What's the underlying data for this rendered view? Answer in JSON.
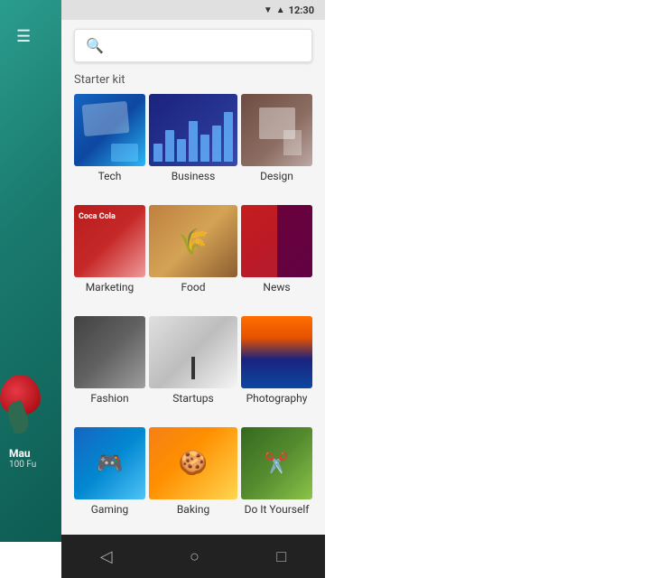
{
  "statusBar": {
    "time": "12:30"
  },
  "header": {
    "hamburgerIcon": "≡",
    "searchPlaceholder": ""
  },
  "sectionLabel": "Starter kit",
  "categories": [
    {
      "id": "tech",
      "label": "Tech",
      "thumbClass": "thumb-tech"
    },
    {
      "id": "business",
      "label": "Business",
      "thumbClass": "thumb-business"
    },
    {
      "id": "design",
      "label": "Design",
      "thumbClass": "thumb-design"
    },
    {
      "id": "marketing",
      "label": "Marketing",
      "thumbClass": "thumb-marketing"
    },
    {
      "id": "food",
      "label": "Food",
      "thumbClass": "thumb-food"
    },
    {
      "id": "news",
      "label": "News",
      "thumbClass": "thumb-news"
    },
    {
      "id": "fashion",
      "label": "Fashion",
      "thumbClass": "thumb-fashion"
    },
    {
      "id": "startups",
      "label": "Startups",
      "thumbClass": "thumb-startups"
    },
    {
      "id": "photography",
      "label": "Photography",
      "thumbClass": "thumb-photography"
    },
    {
      "id": "gaming",
      "label": "Gaming",
      "thumbClass": "thumb-gaming"
    },
    {
      "id": "baking",
      "label": "Baking",
      "thumbClass": "thumb-baking"
    },
    {
      "id": "diy",
      "label": "Do It Yourself",
      "thumbClass": "thumb-diy"
    }
  ],
  "leftPanel": {
    "userName": "Mau",
    "userSub": "100  Fu",
    "hamburger": "☰"
  },
  "navBar": {
    "backIcon": "◁",
    "homeIcon": "○",
    "menuIcon": "□"
  }
}
